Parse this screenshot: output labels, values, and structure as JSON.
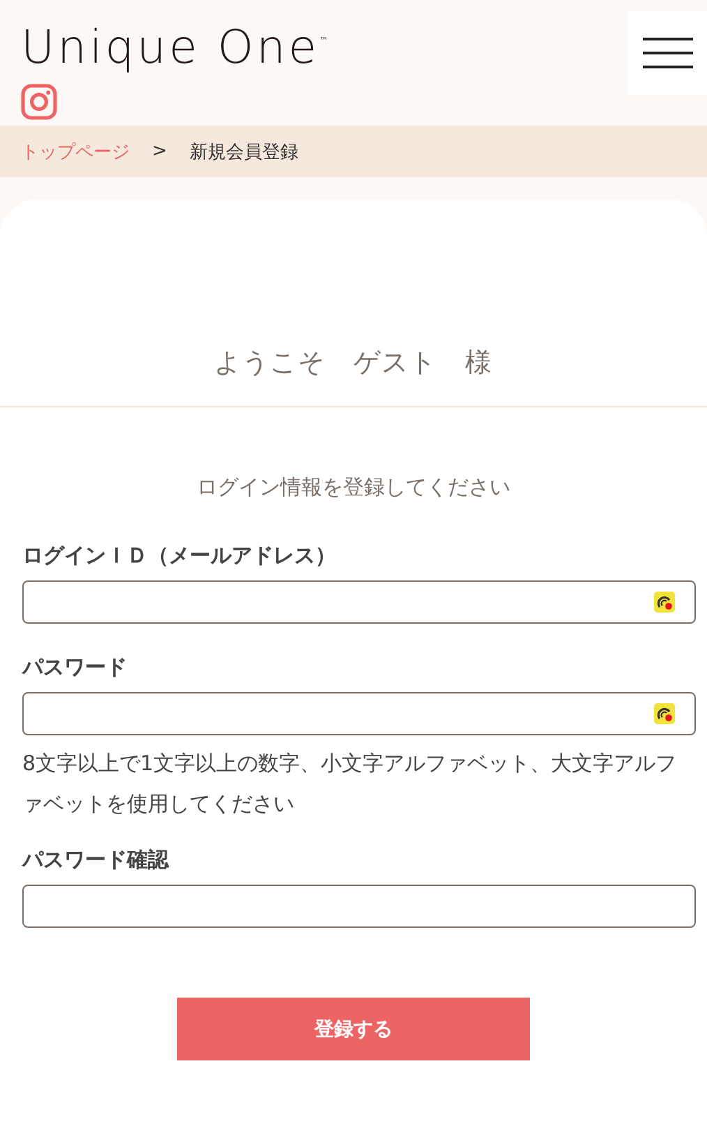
{
  "header": {
    "logo": "Unique One",
    "trademark": "™"
  },
  "breadcrumb": [
    {
      "label": "トップページ",
      "link": true
    },
    {
      "label": ">",
      "link": false
    },
    {
      "label": "新規会員登録",
      "link": false
    }
  ],
  "welcome": "ようこそ　ゲスト　様",
  "intro": "ログイン情報を登録してください",
  "fields": [
    {
      "label": "ログインＩＤ（メールアドレス）",
      "autofill_icon": true
    },
    {
      "label": "パスワード",
      "autofill_icon": true,
      "hint": "8文字以上で1文字以上の数字、小文字アルファベット、大文字アルファベットを使用してください"
    },
    {
      "label": "パスワード確認",
      "autofill_icon": false
    }
  ],
  "submit": "登録する"
}
